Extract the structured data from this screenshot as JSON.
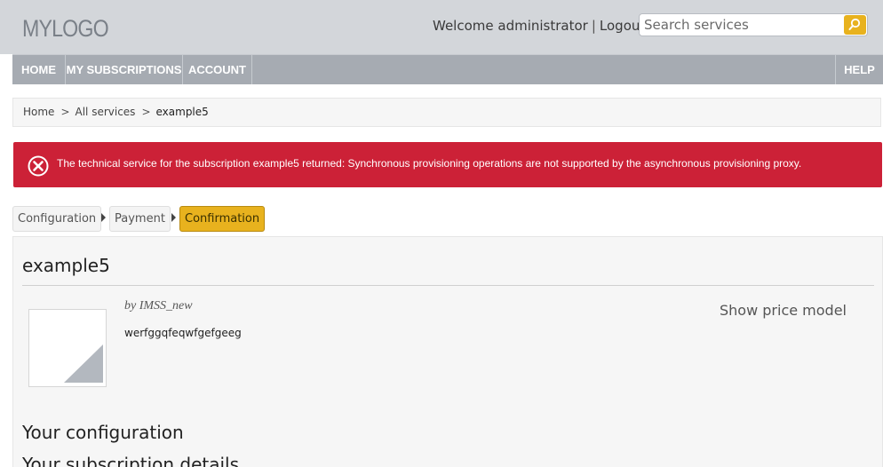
{
  "header": {
    "logo": "MYLOGO",
    "welcome": "Welcome administrator",
    "separator": "|",
    "logout": "Logout",
    "search_placeholder": "Search services"
  },
  "nav": {
    "items": [
      "HOME",
      "MY SUBSCRIPTIONS",
      "ACCOUNT"
    ],
    "help": "HELP"
  },
  "breadcrumb": {
    "home": "Home",
    "all_services": "All services",
    "current": "example5",
    "separator": ">"
  },
  "alert": {
    "message": "The technical service for the subscription example5 returned: Synchronous provisioning operations are not supported by the asynchronous provisioning proxy."
  },
  "steps": {
    "items": [
      "Configuration",
      "Payment",
      "Confirmation"
    ],
    "active": "Confirmation"
  },
  "service": {
    "title": "example5",
    "byline": "by IMSS_new",
    "description": "werfggqfeqwfgefgeeg",
    "show_price_model": "Show price model"
  },
  "sections": {
    "configuration": "Your configuration",
    "subscription_details": "Your subscription details"
  },
  "colors": {
    "accent": "#e8b21e",
    "nav_bg": "#a6abb2",
    "header_bg": "#d3d6da",
    "error": "#cc2137"
  }
}
